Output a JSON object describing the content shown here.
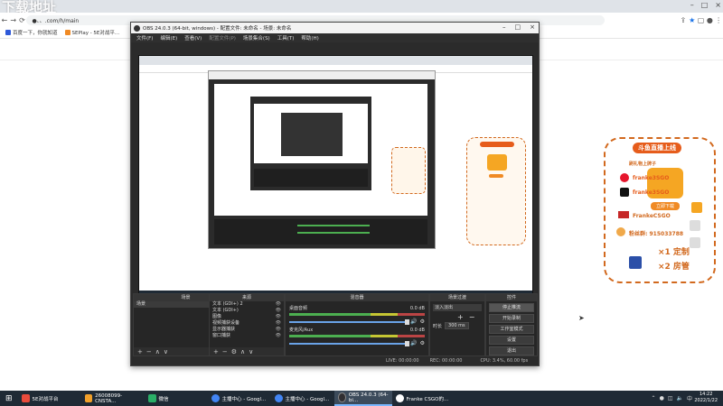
{
  "browser": {
    "tab_watermark": "下载地址",
    "url": "●、、.com/h/main",
    "bookmarks": [
      "百度一下，你就知道",
      "SEPlay - 5E对战平..."
    ],
    "window_controls": [
      "–",
      "□",
      "×"
    ]
  },
  "obs": {
    "title": "OBS 24.0.3 (64-bit, windows) - 配置文件: 未命名 - 场景: 未命名",
    "menu": [
      "文件(F)",
      "编辑(E)",
      "查看(V)",
      "配置文件(P)",
      "场景集合(S)",
      "工具(T)",
      "帮助(H)"
    ],
    "docks": {
      "scenes": {
        "title": "场景",
        "items": [
          "场景"
        ]
      },
      "sources": {
        "title": "来源",
        "items": [
          "文本 (GDI+) 2",
          "文本 (GDI+)",
          "图像",
          "视频捕获设备",
          "显示器捕获",
          "窗口捕获"
        ]
      },
      "mixer": {
        "title": "混音器",
        "channels": [
          {
            "name": "桌面音频",
            "db": "0.0 dB"
          },
          {
            "name": "麦克风/Aux",
            "db": "0.0 dB"
          }
        ]
      },
      "transitions": {
        "title": "场景过渡",
        "type": "淡入淡出",
        "duration_label": "时长",
        "duration": "300 ms"
      },
      "controls": {
        "title": "控件",
        "buttons": [
          "停止推流",
          "开始录制",
          "工作室模式",
          "设置",
          "退出"
        ]
      }
    },
    "status": {
      "live": "LIVE: 00:00:00",
      "rec": "REC: 00:00:00",
      "cpu": "CPU: 3.4%, 60.00 fps"
    }
  },
  "promo": {
    "header": "斗鱼直播上线",
    "subheader": "刷礼物上牌子",
    "weibo": "franke3SGO",
    "douyin": "franke3SGO",
    "app_button": "立即下载",
    "uid": "FrankeCSGO",
    "group": "粉丝群: 915033788",
    "perk1": "×1 定制",
    "perk2": "×2 房管"
  },
  "taskbar": {
    "items": [
      {
        "label": "5E对战平台",
        "color": "#e94b3c"
      },
      {
        "label": "26008099-CNSTA...",
        "color": "#f1a02a"
      },
      {
        "label": "微信",
        "color": "#2aae67"
      },
      {
        "label": "主播中心 - Googl...",
        "color": "#4285f4"
      },
      {
        "label": "主播中心 - Googl...",
        "color": "#4285f4"
      },
      {
        "label": "OBS 24.0.3 (64-bi...",
        "color": "#302e31"
      },
      {
        "label": "Franke CSGO的...",
        "color": "#ffffff"
      }
    ],
    "time": "14:22",
    "date": "2022/1/22"
  }
}
